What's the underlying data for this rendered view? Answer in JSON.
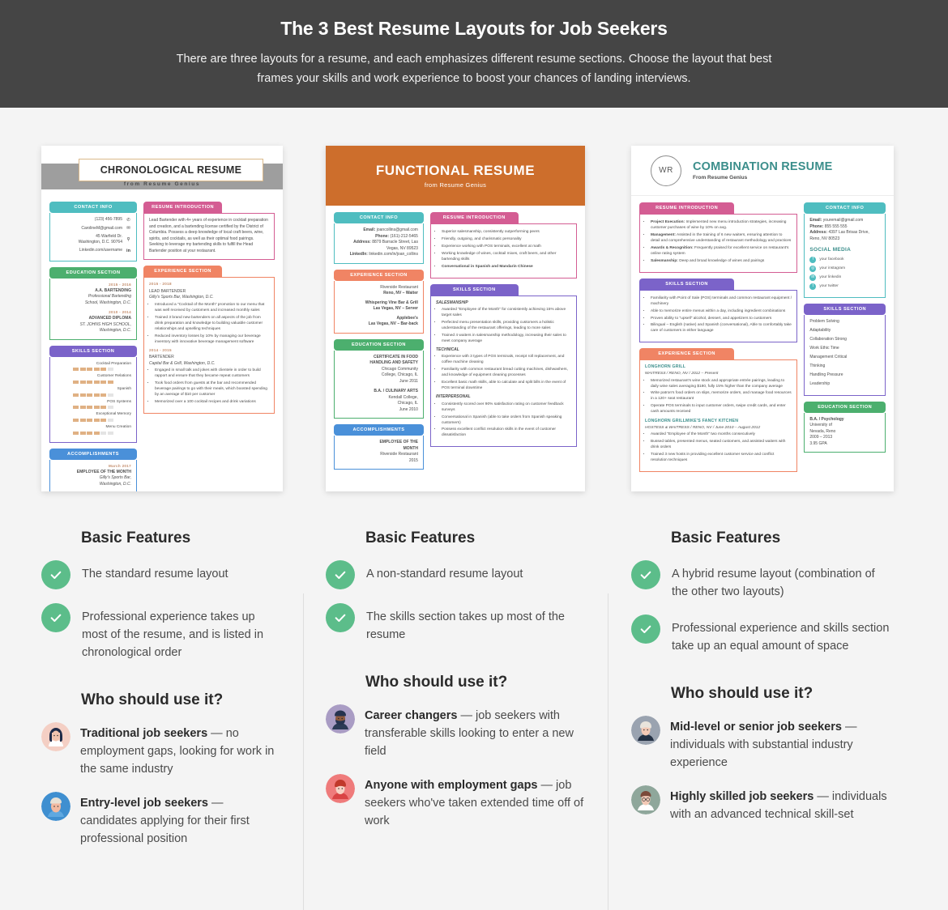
{
  "header": {
    "title": "The 3 Best Resume Layouts for Job Seekers",
    "subtitle": "There are three layouts for a resume, and each emphasizes different resume sections. Choose the layout that best frames your skills and work experience to boost your chances of landing interviews.",
    "bg_color": "#454545"
  },
  "section_labels": {
    "basic_features": "Basic Features",
    "who_should_use": "Who should use it?"
  },
  "colors": {
    "teal": "#4fbdc0",
    "green": "#4caf6e",
    "purple": "#7b63c9",
    "blue": "#4a90d9",
    "pink": "#d45d93",
    "orange": "#f08464",
    "functional_header": "#cd6e2c",
    "combination_accent": "#3b8e8b",
    "check_green": "#5cbd8a",
    "page_bg": "#f4f4f4"
  },
  "columns": [
    {
      "id": "chronological",
      "resume": {
        "title": "CHRONOLOGICAL RESUME",
        "source": "from Resume Genius",
        "contact": {
          "heading": "CONTACT INFO",
          "phone": "(123) 456-7895",
          "email": "CarolineM@gmail.com",
          "address_line1": "45 Warfield Dr.",
          "address_line2": "Washington, D.C. 90764",
          "linkedin": "Linkedin.com/username",
          "icons": [
            "phone-icon",
            "envelope-icon",
            "map-pin-icon",
            "linkedin-icon"
          ]
        },
        "education": {
          "heading": "EDUCATION SECTION",
          "entries": [
            {
              "date": "2015 - 2016",
              "degree": "A.A. BARTENDING",
              "school_italic": "Professional Bartending",
              "school_line2": "School, Washington, D.C."
            },
            {
              "date": "2010 - 2014",
              "degree": "ADVANCED DIPLOMA",
              "school_italic": "ST. JOHNS HIGH SCHOOL,",
              "school_line2": "Washington, D.C."
            }
          ]
        },
        "skills": {
          "heading": "SKILLS SECTION",
          "items": [
            {
              "name": "Cocktail Preparation",
              "filled": 5,
              "total": 6
            },
            {
              "name": "Customer Relations",
              "filled": 6,
              "total": 6
            },
            {
              "name": "Spanish",
              "filled": 5,
              "total": 6
            },
            {
              "name": "POS Systems",
              "filled": 5,
              "total": 6
            },
            {
              "name": "Exceptional Memory",
              "filled": 5,
              "total": 6
            },
            {
              "name": "Menu Creation",
              "filled": 4,
              "total": 6
            }
          ]
        },
        "accomplishments": {
          "heading": "ACCOMPLISHMENTS",
          "date": "March 2017",
          "title": "EMPLOYEE OF THE MONTH",
          "place_italic": "Gilly's Sports Bar,",
          "place_line2": "Washington, D.C."
        },
        "introduction": {
          "heading": "RESUME INTRODUCTION",
          "body": "Lead Bartender with 4+ years of experience in cocktail preparation and creation, and a bartending license certified by the District of Columbia. Possess a deep knowledge of local craft beers, wine, spirits, and cocktails, as well as their optimal food pairings. Seeking to leverage my bartending skills to fulfill the Head Bartender position at your restaurant."
        },
        "experience": {
          "heading": "EXPERIENCE SECTION",
          "jobs": [
            {
              "date": "2015 - 2018",
              "title": "LEAD BARTENDER",
              "company": "Gilly's Sports Bar, Washington, D.C.",
              "bullets": [
                "Introduced a \"Cocktail of the Month\" promotion to our menu that was well received by customers and increased monthly sales",
                "Trained 3 brand new bartenders on all aspects of the job from drink preparation and knowledge to building valuable customer relationships and upselling techniques",
                "Reduced inventory losses by 10% by managing our beverage inventory with innovative beverage management software"
              ]
            },
            {
              "date": "2014 - 2015",
              "title": "BARTENDER",
              "company": "Capital Bar & Grill, Washington, D.C.",
              "bullets": [
                "Engaged in small talk and jokes with clientele in order to build rapport and ensure that they became repeat customers",
                "Took food orders from guests at the bar and recommended beverage pairings to go with their meals, which boosted spending by an average of $10 per customer",
                "Memorized over a 100 cocktail recipes and drink variations"
              ]
            }
          ]
        }
      },
      "features": [
        "The standard resume layout",
        "Professional experience takes up most of the resume, and is listed in chronological order"
      ],
      "who": [
        {
          "bold": "Traditional job seekers",
          "rest": " — no employment gaps, looking for work in the same industry",
          "avatar": "avatar-woman-dark-hair",
          "avatar_bg": "#f4cfc4",
          "hair": "#1f2b48",
          "skin": "#f3c4ae",
          "shirt": "#ffffff"
        },
        {
          "bold": "Entry-level job seekers",
          "rest": " — candidates applying for their first professional position",
          "avatar": "avatar-man-cap",
          "avatar_bg": "#3f8fd0",
          "hair": "#e8e0d4",
          "skin": "#f2b9a0",
          "shirt": "#5fa8e0"
        }
      ]
    },
    {
      "id": "functional",
      "resume": {
        "title": "FUNCTIONAL RESUME",
        "source": "from Resume Genius",
        "contact": {
          "heading": "CONTACT INFO",
          "email_label": "Email:",
          "email": "joancollins@gmail.com",
          "phone_label": "Phone:",
          "phone": "(161)-212-5465",
          "address_label": "Address:",
          "address_line1": "8879 Barracle Street, Las",
          "address_line2": "Vegas, NV 89523",
          "linkedin_label": "LinkedIn:",
          "linkedin": "linkedin.com/in/joan_collins"
        },
        "experience": {
          "heading": "EXPERIENCE SECTION",
          "entries": [
            {
              "line1": "Riverside Restaurant",
              "line2": "Reno, NV – Waiter"
            },
            {
              "line1": "Whispering Vine Bar & Grill",
              "line2": "Las Vegas, NV – Server"
            },
            {
              "line1": "Applebee's",
              "line2": "Las Vegas, NV  – Bar-back"
            }
          ]
        },
        "education": {
          "heading": "EDUCATION SECTION",
          "entries": [
            {
              "degree_line1": "CERTIFICATE IN FOOD",
              "degree_line2": "HANDLING AND SAFETY",
              "school_line1": "Chicago Community",
              "school_line2": "College, Chicago, IL",
              "date": "June 2011"
            },
            {
              "degree_line1": "B.A. / CULINARY ARTS",
              "degree_line2": "",
              "school_line1": "Kendall College,",
              "school_line2": "Chicago, IL",
              "date": "June 2010"
            }
          ]
        },
        "accomplishments": {
          "heading": "ACCOMPLISHMENTS",
          "title_line1": "EMPLOYEE OF THE",
          "title_line2": "MONTH",
          "place": "Riverside Restaurant",
          "date": "2015"
        },
        "introduction": {
          "heading": "RESUME INTRODUCTION",
          "bullets": [
            "Superior salesmanship, consistently outperforming peers",
            "Friendly, outgoing, and charismatic personality",
            "Experience working with POS terminals, excellent at math",
            "Working knowledge of wines, cocktail mixes, craft beers, and other bartending skills",
            "Conversational in Spanish and Mandarin Chinese"
          ],
          "last_bold": true
        },
        "skills": {
          "heading": "SKILLS SECTION",
          "groups": [
            {
              "name": "SALESMANSHIP",
              "bullets": [
                "Awarded \"Employee of the Month\" for consistently achieving 15% above target sales",
                "Perfected menu presentation skills, providing customers a holistic understanding of the restaurant offerings, leading to more sales",
                "Trained 4 waiters in salesmanship methodology, increasing their sales to meet company average"
              ]
            },
            {
              "name": "TECHNICAL",
              "bullets": [
                "Experience with 3 types of POS terminals, receipt roll replacement, and coffee machine cleaning",
                "Familiarity with common restaurant bread cutting machines, dishwashers, and knowledge of equipment cleaning processes",
                "Excellent basic math skills, able to calculate and split bills in the event of POS terminal downtime"
              ]
            },
            {
              "name": "INTERPERSONAL",
              "bullets": [
                "Consistently scored over 90% satisfaction rating on customer feedback surveys",
                "Conversational in Spanish (able to take orders from Spanish speaking customers)",
                "Possess excellent conflict resolution skills in the event of customer dissatisfaction"
              ]
            }
          ]
        }
      },
      "features": [
        "A non-standard resume layout",
        "The skills section takes up most of the resume"
      ],
      "who": [
        {
          "bold": "Career changers",
          "rest": " — job seekers with transferable skills looking to enter a new field",
          "avatar": "avatar-man-beard",
          "avatar_bg": "#a99cc4",
          "hair": "#26334f",
          "skin": "#8d5a3f",
          "shirt": "#2b3a55"
        },
        {
          "bold": "Anyone with employment gaps",
          "rest": " — job seekers who've taken extended time off of work",
          "avatar": "avatar-woman-red-hair",
          "avatar_bg": "#ef7b7b",
          "hair": "#c0392b",
          "skin": "#f7d2c4",
          "shirt": "#d94444"
        }
      ]
    },
    {
      "id": "combination",
      "resume": {
        "title": "COMBINATION RESUME",
        "source": "From Resume Genius",
        "monogram": "WR",
        "introduction": {
          "heading": "RESUME INTRODUCTION",
          "bullets": [
            {
              "bold": "Project Execution:",
              "text": " Implemented new menu introduction strategies, increasing customer purchases of wine by 10% on avg."
            },
            {
              "bold": "Management:",
              "text": " Assisted in the training of 6 new waiters, ensuring attention to detail and comprehensive understanding of restaurant methodology and practices"
            },
            {
              "bold": "Awards & Recognition:",
              "text": " Frequently praised for excellent service on restaurant's online rating system"
            },
            {
              "bold": "Salesmanship:",
              "text": " Deep and broad knowledge of wines and pairings"
            }
          ]
        },
        "skills": {
          "heading": "SKILLS SECTION",
          "bullets": [
            "Familiarity with Point of Sale (POS) terminals and common restaurant equipment / machinery",
            "Able to memorize entire menus within a day, including ingredient combinations",
            "Proven ability to \"upsell\" alcohol, dessert, and appetizers to customers",
            "Bilingual – English (native) and Spanish (conversational), Able to comfortably take care of customers in either language"
          ]
        },
        "experience": {
          "heading": "EXPERIENCE SECTION",
          "jobs": [
            {
              "company": "LONGHORN GRILL",
              "role": "WAITRESS  /  RENO, NV  /  2012 – Present",
              "bullets": [
                "Memorized restaurant's wine stock and appropriate entrée pairings, leading to daily wine sales averaging $180, fully 15% higher than the company average",
                "Write patron's food orders on slips, memorize orders, and manage food resources in a 120+ seat restaurant",
                "Operate POS terminals to input customer orders, swipe credit cards, and enter cash amounts received"
              ]
            },
            {
              "company": "LONGHORN GRILLMIKE'S FANCY KITCHEN",
              "role": "HOSTESS & WAITRESS  /  RENO, NV  /  June 2010 – August 2012",
              "bullets": [
                "Awarded \"Employee of the Month\" two months consecutively",
                "Bussed tables, presented menus, seated customers, and assisted waiters with drink orders",
                "Trained 3 new hosts in providing excellent customer service and conflict resolution techniques"
              ]
            }
          ]
        },
        "contact": {
          "heading": "CONTACT INFO",
          "email_label": "Email:",
          "email": "youremail@gmail.com",
          "phone_label": "Phone:",
          "phone": "855 555 555",
          "address_label": "Address:",
          "address_line1": "4397 Las Brisas Drive,",
          "address_line2": "Reno, NV 80523",
          "social_heading": "SOCIAL MEDIA",
          "social": [
            {
              "label": "your facebook",
              "icon": "facebook-icon"
            },
            {
              "label": "your instagram",
              "icon": "instagram-icon"
            },
            {
              "label": "your linkedin",
              "icon": "linkedin-icon"
            },
            {
              "label": "your twitter",
              "icon": "twitter-icon"
            }
          ]
        },
        "side_skills": {
          "heading": "SKILLS SECTION",
          "items": [
            "Problem Solving",
            "Adaptability",
            "Collaboration Strong",
            "Work Ethic Time",
            "Management Critical",
            "Thinking",
            "Handling Pressure",
            "Leadership"
          ]
        },
        "side_education": {
          "heading": "EDUCATION SECTION",
          "degree": "B.A. / Psychology",
          "school_line1": "University of",
          "school_line2": "Nevada, Reno",
          "dates": "2009 – 2013",
          "gpa": "3.95 GPA"
        }
      },
      "features": [
        "A hybrid resume layout (combination of the other two layouts)",
        "Professional experience and skills section take up an equal amount of space"
      ],
      "who": [
        {
          "bold": "Mid-level or senior job seekers",
          "rest": " — individuals with substantial industry experience",
          "avatar": "avatar-senior-woman",
          "avatar_bg": "#9aa3b0",
          "hair": "#e9e4dc",
          "skin": "#f3c9b6",
          "shirt": "#233044"
        },
        {
          "bold": "Highly skilled job seekers",
          "rest": " — individuals with an advanced technical skill-set",
          "avatar": "avatar-man-glasses",
          "avatar_bg": "#8fa79b",
          "hair": "#7b4a3a",
          "skin": "#f3c9b6",
          "shirt": "#ffffff"
        }
      ]
    }
  ]
}
